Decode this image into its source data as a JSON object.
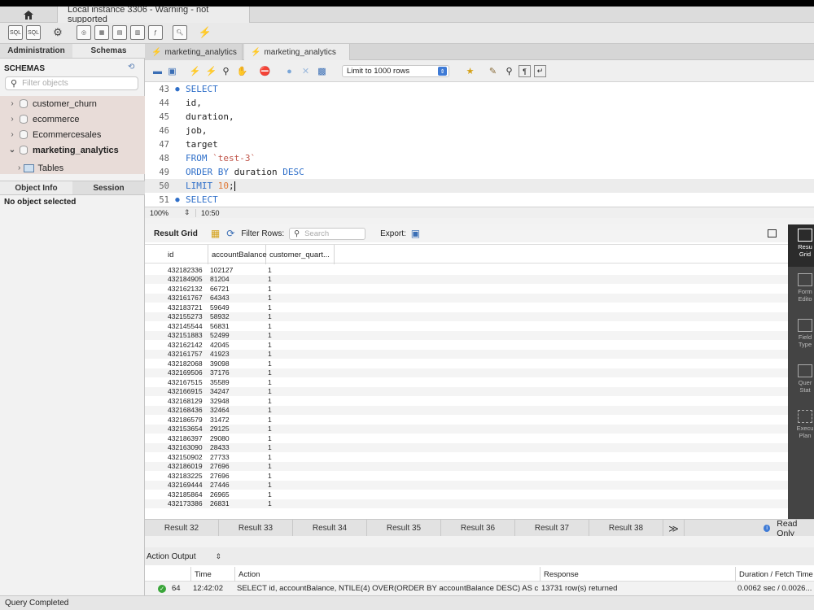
{
  "window": {
    "instance_tab": "Local instance 3306 - Warning - not supported"
  },
  "sidebar": {
    "tabs": [
      "Administration",
      "Schemas"
    ],
    "schemas_title": "SCHEMAS",
    "filter_placeholder": "Filter objects",
    "schemas": [
      "customer_churn",
      "ecommerce",
      "Ecommercesales",
      "marketing_analytics"
    ],
    "tables_label": "Tables",
    "info_tabs": [
      "Object Info",
      "Session"
    ],
    "no_object": "No object selected"
  },
  "editor": {
    "tabs": [
      "marketing_analytics",
      "marketing_analytics"
    ],
    "limit_label": "Limit to 1000 rows",
    "zoom": "100%",
    "cursor_pos": "10:50",
    "lines": [
      {
        "n": "43",
        "marker": true,
        "text": "SELECT"
      },
      {
        "n": "44",
        "marker": false,
        "text": "id,"
      },
      {
        "n": "45",
        "marker": false,
        "text": "duration,"
      },
      {
        "n": "46",
        "marker": false,
        "text": "job,"
      },
      {
        "n": "47",
        "marker": false,
        "text": "target"
      },
      {
        "n": "48",
        "marker": false,
        "text": "FROM `test-3`"
      },
      {
        "n": "49",
        "marker": false,
        "text": "ORDER BY duration DESC"
      },
      {
        "n": "50",
        "marker": false,
        "text": "LIMIT 10;"
      },
      {
        "n": "51",
        "marker": true,
        "text": "SELECT"
      }
    ]
  },
  "result": {
    "toolbar": {
      "result_grid": "Result Grid",
      "filter_rows": "Filter Rows:",
      "search_placeholder": "Search",
      "export": "Export:"
    },
    "columns": [
      "id",
      "accountBalance",
      "customer_quart..."
    ],
    "rows": [
      [
        "432182336",
        "102127",
        "1"
      ],
      [
        "432184905",
        "81204",
        "1"
      ],
      [
        "432162132",
        "66721",
        "1"
      ],
      [
        "432161767",
        "64343",
        "1"
      ],
      [
        "432183721",
        "59649",
        "1"
      ],
      [
        "432155273",
        "58932",
        "1"
      ],
      [
        "432145544",
        "56831",
        "1"
      ],
      [
        "432151883",
        "52499",
        "1"
      ],
      [
        "432162142",
        "42045",
        "1"
      ],
      [
        "432161757",
        "41923",
        "1"
      ],
      [
        "432182068",
        "39098",
        "1"
      ],
      [
        "432169506",
        "37176",
        "1"
      ],
      [
        "432167515",
        "35589",
        "1"
      ],
      [
        "432166915",
        "34247",
        "1"
      ],
      [
        "432168129",
        "32948",
        "1"
      ],
      [
        "432168436",
        "32464",
        "1"
      ],
      [
        "432186579",
        "31472",
        "1"
      ],
      [
        "432153654",
        "29125",
        "1"
      ],
      [
        "432186397",
        "29080",
        "1"
      ],
      [
        "432163090",
        "28433",
        "1"
      ],
      [
        "432150902",
        "27733",
        "1"
      ],
      [
        "432186019",
        "27696",
        "1"
      ],
      [
        "432183225",
        "27696",
        "1"
      ],
      [
        "432169444",
        "27446",
        "1"
      ],
      [
        "432185864",
        "26965",
        "1"
      ],
      [
        "432173386",
        "26831",
        "1"
      ]
    ],
    "side_panel": [
      {
        "l1": "Resu",
        "l2": "Grid"
      },
      {
        "l1": "Form",
        "l2": "Edito"
      },
      {
        "l1": "Field",
        "l2": "Type"
      },
      {
        "l1": "Quer",
        "l2": "Stat"
      },
      {
        "l1": "Execu",
        "l2": "Plan"
      }
    ],
    "tabs": [
      "Result 32",
      "Result 33",
      "Result 34",
      "Result 35",
      "Result 36",
      "Result 37",
      "Result 38"
    ],
    "overflow_label": "≫",
    "read_only": "Read Only"
  },
  "action_output": {
    "title": "Action Output",
    "columns": [
      "Time",
      "Action",
      "Response",
      "Duration / Fetch Time"
    ],
    "row": {
      "num": "64",
      "time": "12:42:02",
      "action": "SELECT id, accountBalance, NTILE(4) OVER(ORDER BY accountBalance DESC) AS cu...",
      "response": "13731 row(s) returned",
      "duration": "0.0062 sec / 0.0026..."
    }
  },
  "status": "Query Completed",
  "colors": {
    "keyword": "#2f6fc9",
    "string": "#c0554a",
    "number": "#e07b39",
    "schema_bg": "#e8dcd8",
    "ok": "#3aa63a"
  }
}
